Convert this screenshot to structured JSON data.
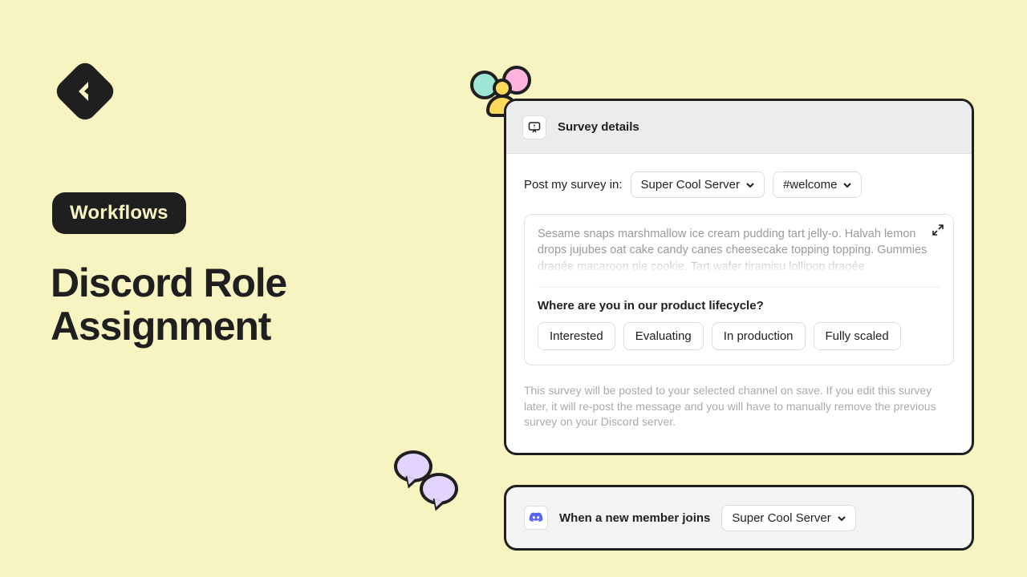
{
  "badge": "Workflows",
  "title_line1": "Discord Role",
  "title_line2": "Assignment",
  "survey": {
    "header": "Survey details",
    "post_label": "Post my survey in:",
    "server": "Super Cool Server",
    "channel": "#welcome",
    "placeholder_text": "Sesame snaps marshmallow ice cream pudding tart jelly-o. Halvah lemon drops jujubes oat cake candy canes cheesecake topping topping. Gummies dragée macaroon pie cookie. Tart wafer tiramisu lollipop dragée",
    "question": "Where are you in our product lifecycle?",
    "options": [
      "Interested",
      "Evaluating",
      "In production",
      "Fully scaled"
    ],
    "footnote": "This survey will be posted to your selected channel on save. If you edit this survey later, it will re-post the message and you will have to manually remove the previous survey on your Discord server."
  },
  "trigger": {
    "text": "When a new member joins",
    "server": "Super Cool Server"
  }
}
